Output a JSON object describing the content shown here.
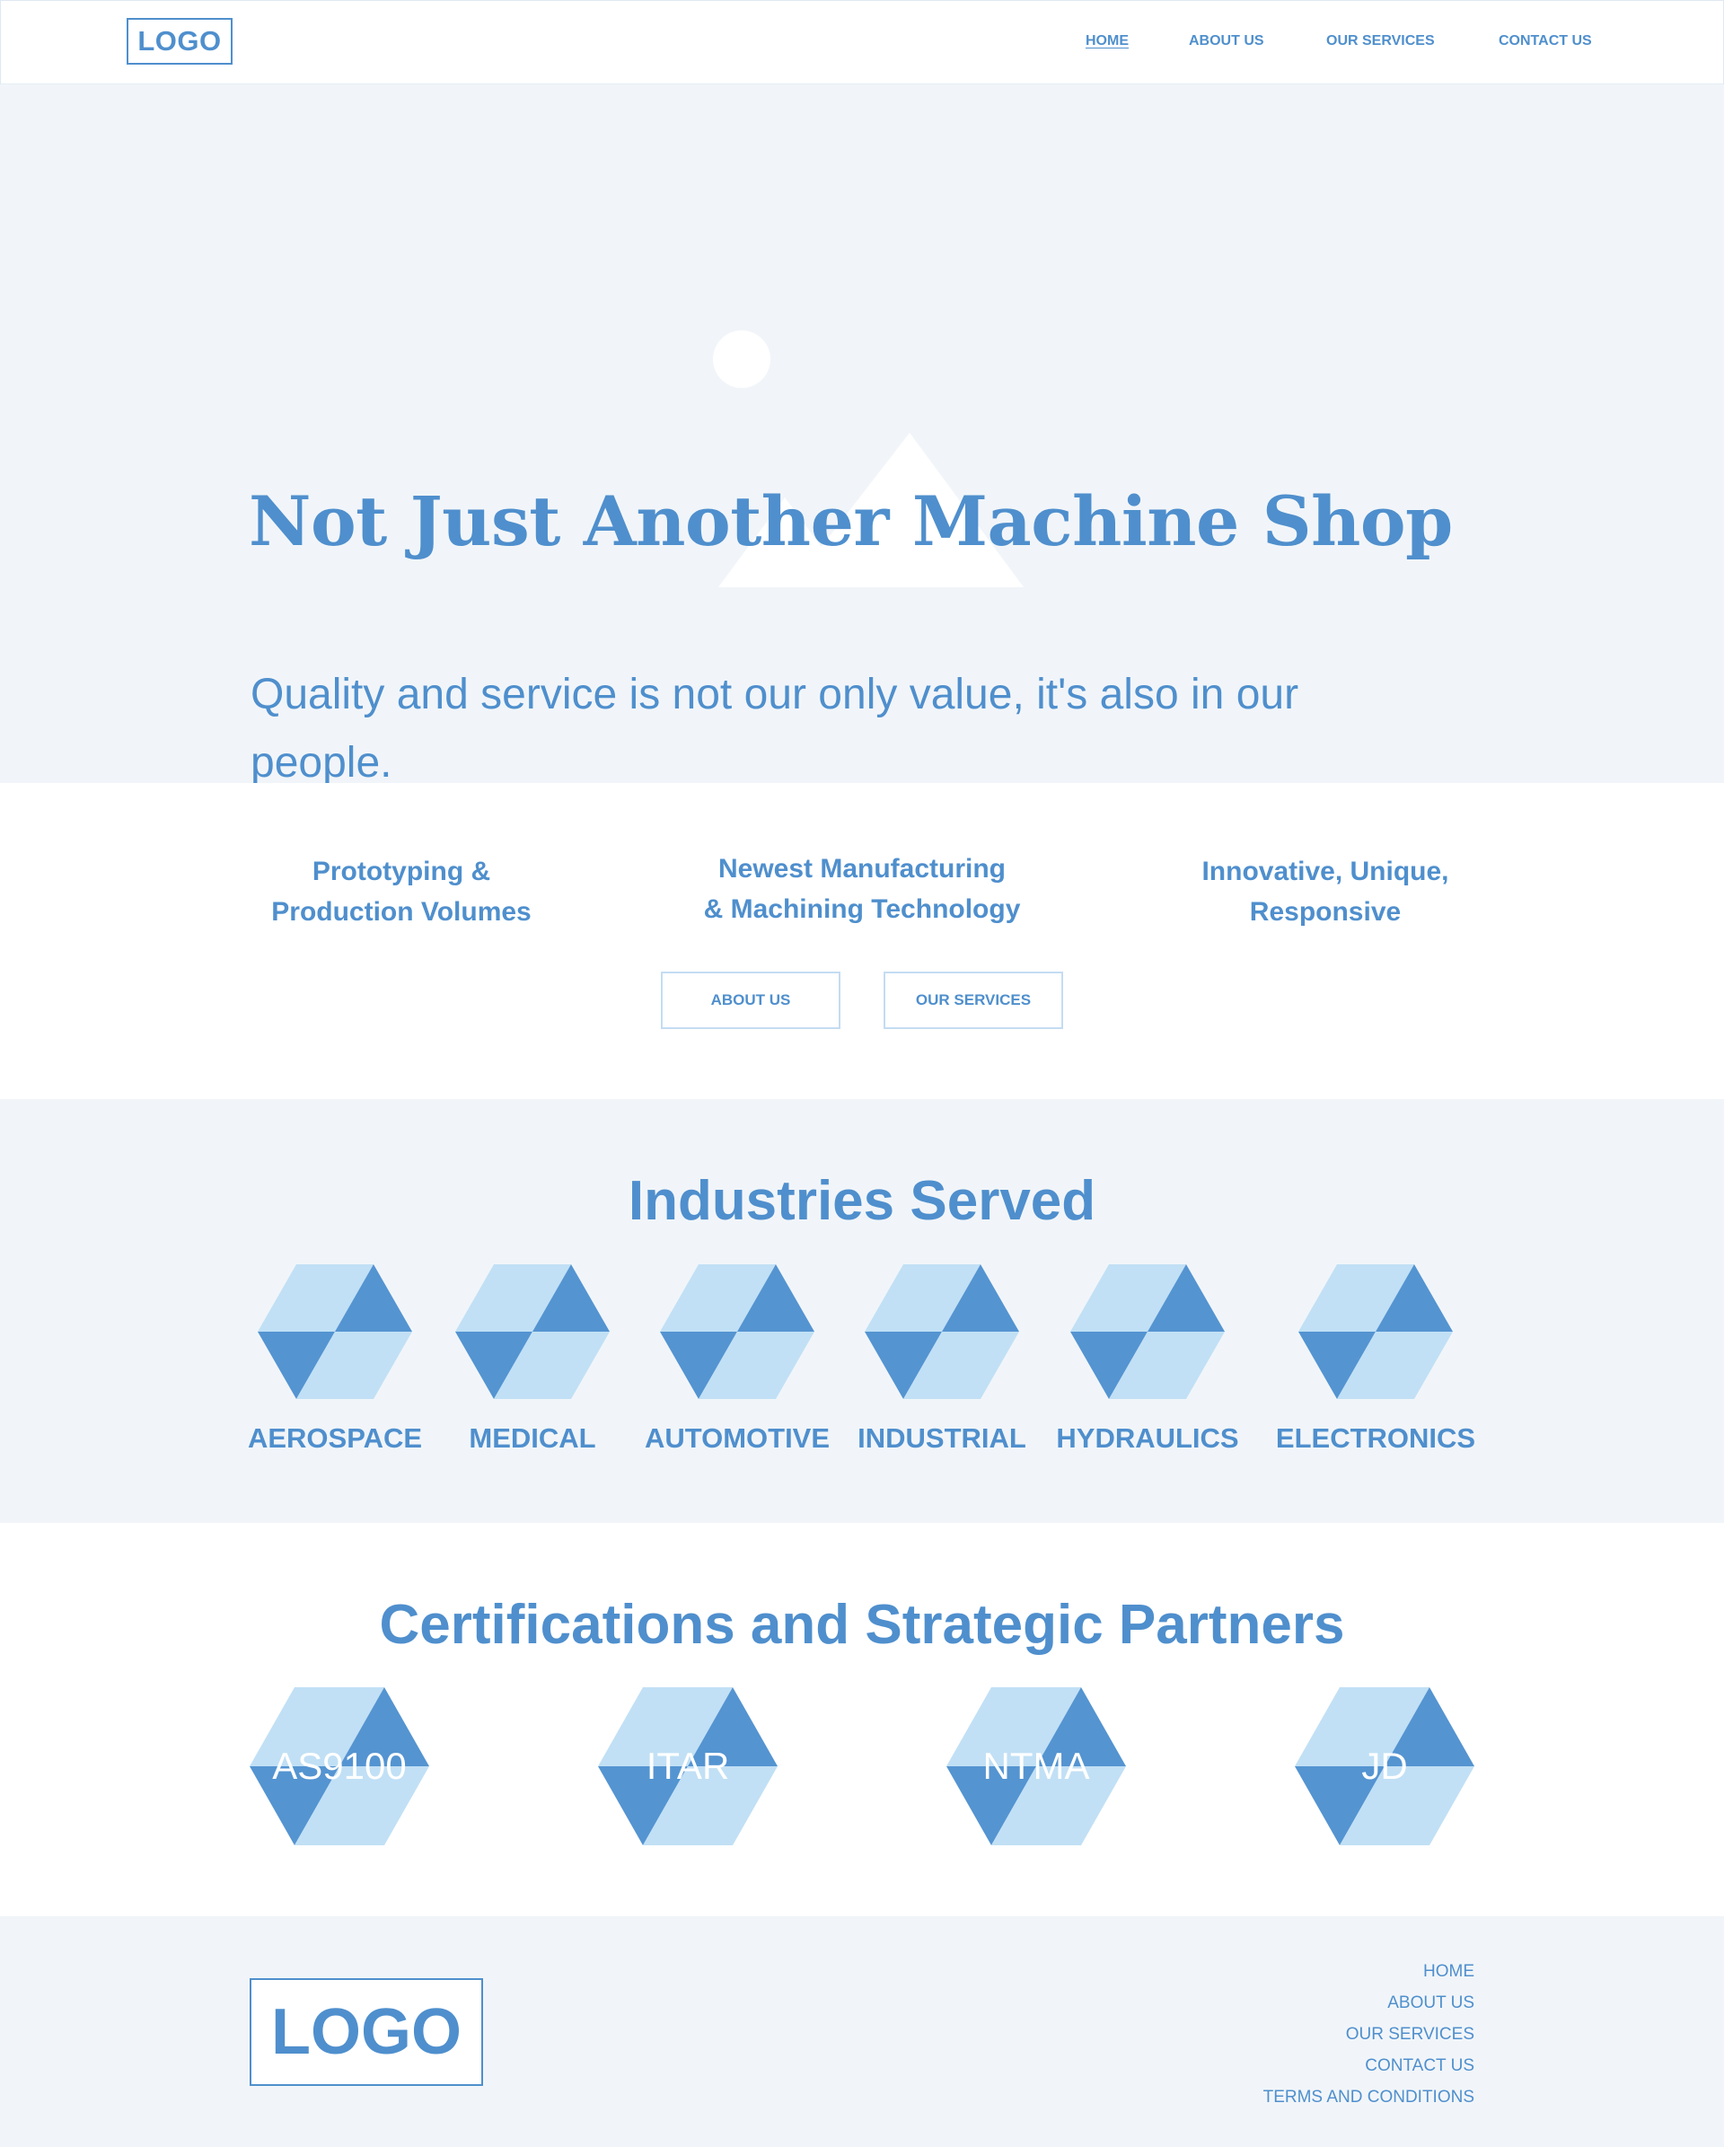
{
  "header": {
    "logo": "LOGO",
    "nav": [
      "HOME",
      "ABOUT US",
      "OUR SERVICES",
      "CONTACT US"
    ]
  },
  "hero": {
    "image_icon": "image-placeholder-icon",
    "title": "Not Just Another Machine Shop",
    "subtitle": "Quality and service is not our only value, it's also in our people."
  },
  "features": {
    "items": [
      {
        "line1": "Prototyping &",
        "line2": "Production Volumes"
      },
      {
        "line1": "Newest Manufacturing",
        "line2": "& Machining Technology"
      },
      {
        "line1": "Innovative, Unique,",
        "line2": "Responsive"
      }
    ],
    "buttons": [
      "ABOUT US",
      "OUR SERVICES"
    ]
  },
  "industries": {
    "title": "Industries Served",
    "icon": "hexagon-cube-icon",
    "items": [
      "AEROSPACE",
      "MEDICAL",
      "AUTOMOTIVE",
      "INDUSTRIAL",
      "HYDRAULICS",
      "ELECTRONICS"
    ]
  },
  "certifications": {
    "title": "Certifications and Strategic Partners",
    "icon": "hexagon-cube-icon",
    "items": [
      "AS9100",
      "ITAR",
      "NTMA",
      "JD"
    ]
  },
  "footer": {
    "logo": "LOGO",
    "links": [
      "HOME",
      "ABOUT US",
      "OUR SERVICES",
      "CONTACT US",
      "TERMS AND CONDITIONS"
    ]
  },
  "colors": {
    "accent": "#4f8fcd",
    "hex_light": "#c1e0f5",
    "hex_dark": "#5494d1",
    "section_bg": "#f1f5f9"
  }
}
